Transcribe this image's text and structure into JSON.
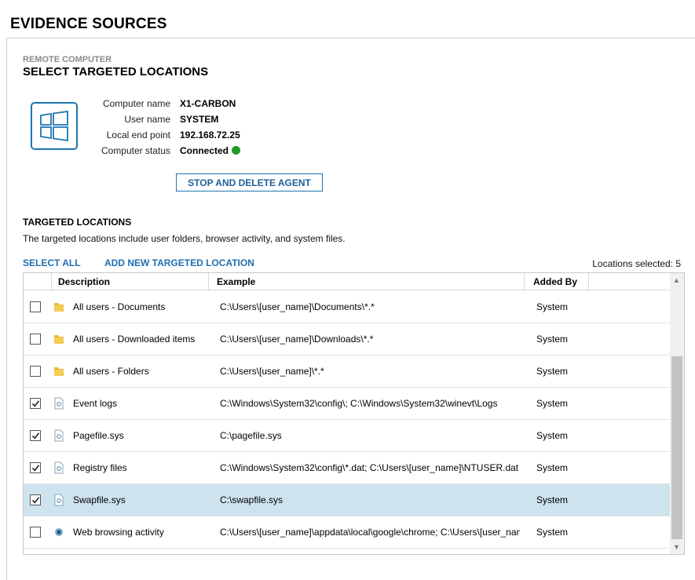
{
  "page": {
    "title": "EVIDENCE SOURCES"
  },
  "remote": {
    "kicker": "REMOTE COMPUTER",
    "title": "SELECT TARGETED LOCATIONS",
    "icon": "windows-logo-icon",
    "info": [
      {
        "label": "Computer name",
        "value": "X1-CARBON"
      },
      {
        "label": "User name",
        "value": "SYSTEM"
      },
      {
        "label": "Local end point",
        "value": "192.168.72.25"
      },
      {
        "label": "Computer status",
        "value": "Connected"
      }
    ],
    "status_color": "#1f9a2a",
    "stop_button": "STOP AND DELETE AGENT"
  },
  "targeted": {
    "heading": "TARGETED LOCATIONS",
    "description": "The targeted locations include user folders, browser activity, and system files.",
    "select_all": "SELECT ALL",
    "add_new": "ADD NEW TARGETED LOCATION",
    "count": "Locations selected: 5"
  },
  "grid": {
    "columns": {
      "description": "Description",
      "example": "Example",
      "added_by": "Added By"
    },
    "rows": [
      {
        "checked": false,
        "icon": "folder-icon",
        "description": "All users - Documents",
        "example": "C:\\Users\\[user_name]\\Documents\\*.*",
        "added_by": "System"
      },
      {
        "checked": false,
        "icon": "folder-icon",
        "description": "All users - Downloaded items",
        "example": "C:\\Users\\[user_name]\\Downloads\\*.*",
        "added_by": "System"
      },
      {
        "checked": false,
        "icon": "folder-icon",
        "description": "All users - Folders",
        "example": "C:\\Users\\[user_name]\\*.*",
        "added_by": "System"
      },
      {
        "checked": true,
        "icon": "system-file-icon",
        "description": "Event logs",
        "example": "C:\\Windows\\System32\\config\\; C:\\Windows\\System32\\winevt\\Logs",
        "added_by": "System"
      },
      {
        "checked": true,
        "icon": "system-file-icon",
        "description": "Pagefile.sys",
        "example": "C:\\pagefile.sys",
        "added_by": "System"
      },
      {
        "checked": true,
        "icon": "system-file-icon",
        "description": "Registry files",
        "example": "C:\\Windows\\System32\\config\\*.dat; C:\\Users\\[user_name]\\NTUSER.dat",
        "added_by": "System"
      },
      {
        "checked": true,
        "icon": "system-file-icon",
        "description": "Swapfile.sys",
        "example": "C:\\swapfile.sys",
        "added_by": "System",
        "selected": true
      },
      {
        "checked": false,
        "icon": "web-browser-icon",
        "description": "Web browsing activity",
        "example": "C:\\Users\\[user_name]\\appdata\\local\\google\\chrome; C:\\Users\\[user_name]",
        "added_by": "System"
      }
    ]
  },
  "colors": {
    "accent": "#1f6fb0",
    "selected_row": "#cde3ee"
  }
}
